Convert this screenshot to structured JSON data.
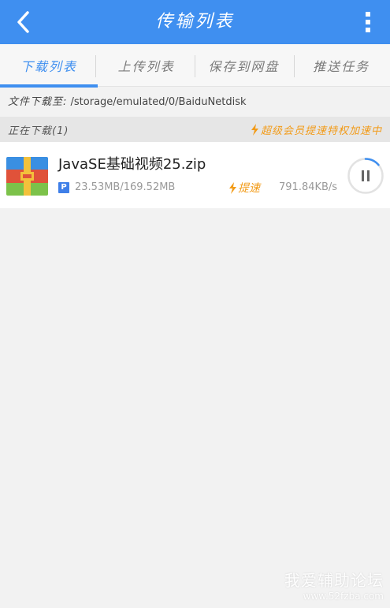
{
  "header": {
    "title": "传输列表",
    "back_icon": "chevron-left-icon",
    "more_icon": "more-vertical-icon"
  },
  "tabs": [
    {
      "label": "下载列表",
      "active": true
    },
    {
      "label": "上传列表",
      "active": false
    },
    {
      "label": "保存到网盘",
      "active": false
    },
    {
      "label": "推送任务",
      "active": false
    }
  ],
  "path": {
    "label": "文件下载至:",
    "value": "/storage/emulated/0/BaiduNetdisk"
  },
  "section": {
    "title": "正在下载(1)",
    "promo": "超级会员提速特权加速中"
  },
  "downloads": [
    {
      "name": "JavaSE基础视频25.zip",
      "badge": "P",
      "size": "23.53MB/169.52MB",
      "speedup_label": "提速",
      "rate": "791.84KB/s",
      "progress": 0.139
    }
  ],
  "watermark": {
    "line1": "我爱辅助论坛",
    "line2": "www.52fzba.com"
  },
  "colors": {
    "accent": "#3f8ff0",
    "promo": "#f29b18"
  }
}
